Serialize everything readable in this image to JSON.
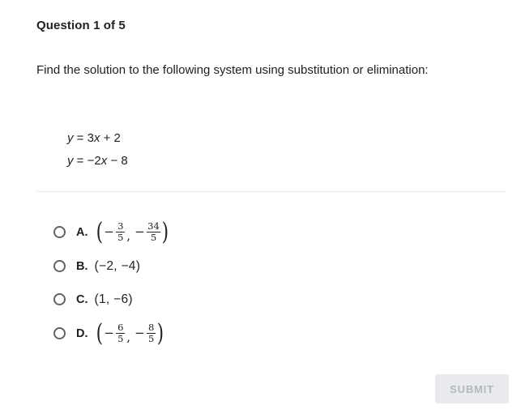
{
  "header": {
    "question_label": "Question 1 of 5"
  },
  "prompt": {
    "text": "Find the solution to the following system using substitution or elimination:"
  },
  "equations": [
    {
      "lhs": "y",
      "rel": " = ",
      "rhs_pre": "3",
      "rhs_var": "x",
      "rhs_post": " + 2",
      "plain": "y = 3x + 2"
    },
    {
      "lhs": "y",
      "rel": " = ",
      "rhs_pre": "−2",
      "rhs_var": "x",
      "rhs_post": " − 8",
      "plain": "y = −2x − 8"
    }
  ],
  "choices": [
    {
      "letter": "A.",
      "style": "math",
      "value_text": "(−3/5, −34/5)",
      "x": {
        "sign": "−",
        "numerator": "3",
        "denominator": "5"
      },
      "y": {
        "sign": "−",
        "numerator": "34",
        "denominator": "5"
      },
      "selected": false
    },
    {
      "letter": "B.",
      "style": "plain",
      "value_text": "(−2, −4)",
      "selected": false
    },
    {
      "letter": "C.",
      "style": "plain",
      "value_text": "(1, −6)",
      "selected": false
    },
    {
      "letter": "D.",
      "style": "math",
      "value_text": "(−6/5, −8/5)",
      "x": {
        "sign": "−",
        "numerator": "6",
        "denominator": "5"
      },
      "y": {
        "sign": "−",
        "numerator": "8",
        "denominator": "5"
      },
      "selected": false
    }
  ],
  "footer": {
    "submit_label": "SUBMIT",
    "submit_disabled": true
  },
  "colors": {
    "text": "#202124",
    "divider": "#e8e8e8",
    "radio_border": "#5f6368",
    "submit_bg": "#e8eaed",
    "submit_text": "#b5b8bb",
    "background": "#ffffff"
  },
  "symbols": {
    "paren_open": "(",
    "paren_close": ")",
    "comma": ",",
    "minus": "−"
  }
}
